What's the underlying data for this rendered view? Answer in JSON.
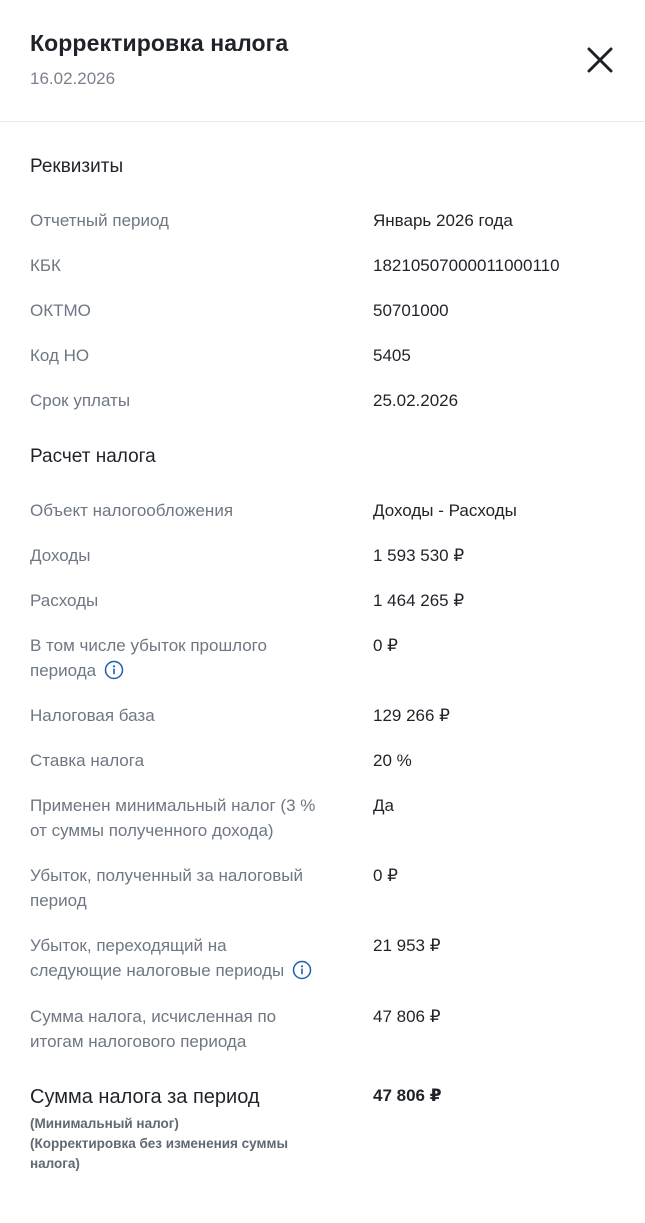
{
  "header": {
    "title": "Корректировка налога",
    "date": "16.02.2026"
  },
  "requisites": {
    "title": "Реквизиты",
    "rows": [
      {
        "label": "Отчетный период",
        "value": "Январь 2026 года"
      },
      {
        "label": "КБК",
        "value": "18210507000011000110"
      },
      {
        "label": "ОКТМО",
        "value": "50701000"
      },
      {
        "label": "Код НО",
        "value": "5405"
      },
      {
        "label": "Срок уплаты",
        "value": "25.02.2026"
      }
    ]
  },
  "calculation": {
    "title": "Расчет налога",
    "rows": [
      {
        "label": "Объект налогообложения",
        "value": "Доходы - Расходы"
      },
      {
        "label": "Доходы",
        "value": "1 593 530 ₽"
      },
      {
        "label": "Расходы",
        "value": "1 464 265 ₽"
      },
      {
        "label_line1": "В том числе убыток прошлого",
        "label_line2": "периода",
        "value": "0 ₽"
      },
      {
        "label": "Налоговая база",
        "value": "129 266 ₽"
      },
      {
        "label": "Ставка налога",
        "value": "20 %"
      },
      {
        "label_line1": "Применен минимальный налог (3 %",
        "label_line2": "от суммы полученного дохода)",
        "value": "Да"
      },
      {
        "label_line1": "Убыток, полученный за налоговый",
        "label_line2": "период",
        "value": "0 ₽"
      },
      {
        "label_line1": "Убыток, переходящий на",
        "label_line2": "следующие налоговые периоды",
        "value": "21 953 ₽"
      },
      {
        "label_line1": "Сумма налога, исчисленная по",
        "label_line2": "итогам налогового периода",
        "value": "47 806 ₽"
      }
    ]
  },
  "total": {
    "label": "Сумма налога за период",
    "note1": "(Минимальный налог)",
    "note2_line1": "(Корректировка без изменения суммы",
    "note2_line2": "налога)",
    "value": "47 806 ₽"
  },
  "icons": {
    "close": "close-icon",
    "info": "info-icon",
    "info_color": "#1f5fa8"
  }
}
